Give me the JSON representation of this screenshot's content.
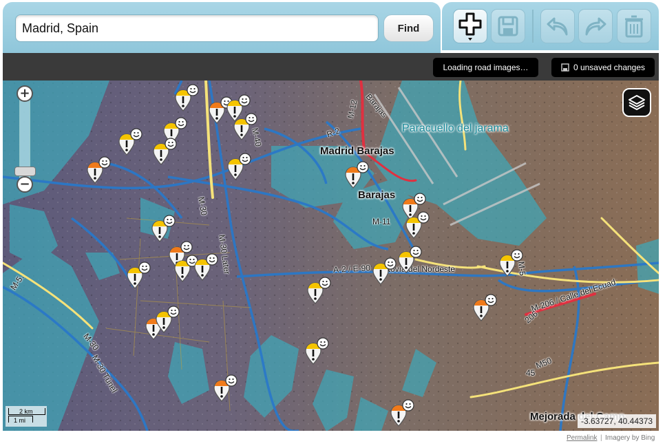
{
  "search": {
    "value": "Madrid, Spain"
  },
  "toolbar": {
    "find_label": "Find",
    "icons": [
      "add-pin-icon",
      "save-icon",
      "undo-icon",
      "redo-icon",
      "trash-icon"
    ]
  },
  "status": {
    "loading": "Loading road images…",
    "unsaved": "0 unsaved changes"
  },
  "map": {
    "places": [
      {
        "name": "Paracuello del jarama",
        "color": "#1b8b9a"
      },
      {
        "name": "Madrid Barajas",
        "color": "#1b8b9a"
      },
      {
        "name": "Barajas",
        "color": "#111111"
      },
      {
        "name": "Mejorada del Camp",
        "color": "#111111"
      }
    ],
    "roads": [
      "M-12",
      "Barajas",
      "R-2",
      "M-40",
      "M-11",
      "M-30",
      "M-30 Later",
      "A-2 / E-90",
      "Autovía del Nordeste",
      "M-5",
      "M-206 / Calle del Ecuad",
      "206",
      "M-30",
      "M-30 Túnel",
      "M-5.",
      "M50",
      "45"
    ],
    "scale": {
      "km": "2 km",
      "mi": "1 mi"
    },
    "coords": "-3.63727, 40.44373"
  },
  "footer": {
    "permalink": "Permalink",
    "imagery": "Imagery by Bing"
  },
  "colors": {
    "toolbar": "#9ccfe1",
    "accent_orange": "#f07a1a",
    "accent_yellow": "#f5c400",
    "water_teal": "#3fa7b8"
  }
}
